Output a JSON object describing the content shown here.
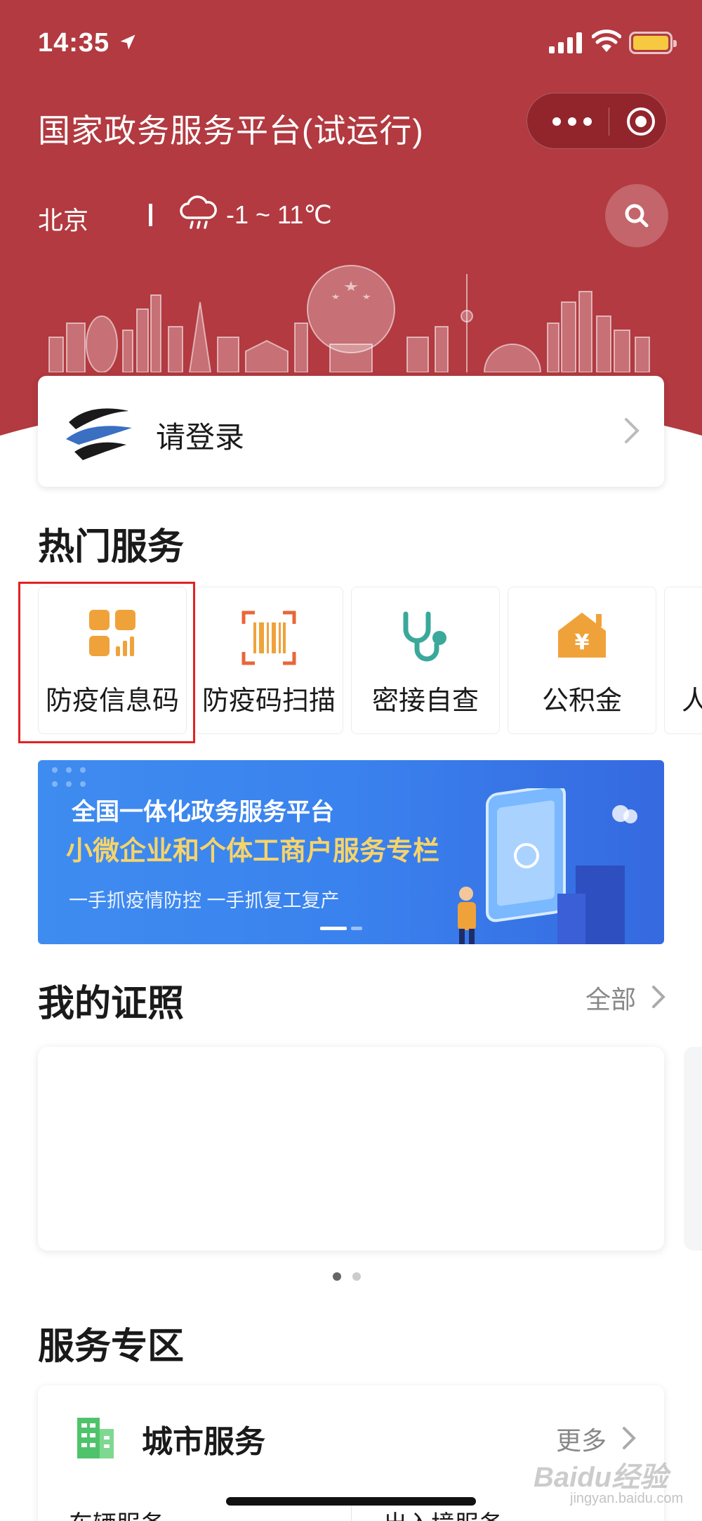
{
  "status_bar": {
    "time": "14:35"
  },
  "header": {
    "title": "国家政务服务平台(试运行)",
    "city": "北京",
    "weather": "-1 ~ 11℃"
  },
  "login": {
    "label": "请登录"
  },
  "hot_services": {
    "title": "热门服务",
    "items": [
      {
        "label": "防疫信息码",
        "icon": "grid-bars-icon"
      },
      {
        "label": "防疫码扫描",
        "icon": "barcode-scan-icon"
      },
      {
        "label": "密接自查",
        "icon": "stethoscope-icon"
      },
      {
        "label": "公积金",
        "icon": "house-yen-icon"
      },
      {
        "label": "人",
        "icon": ""
      }
    ]
  },
  "banner": {
    "line1": "全国一体化政务服务平台",
    "line2": "小微企业和个体工商户服务专栏",
    "line3": "一手抓疫情防控  一手抓复工复产"
  },
  "certificates": {
    "title": "我的证照",
    "all_label": "全部"
  },
  "service_zone": {
    "title": "服务专区",
    "card_title": "城市服务",
    "more_label": "更多",
    "items": [
      "车辆服务",
      "出入境服务"
    ]
  },
  "watermark": {
    "text": "Baidu经验",
    "sub": "jingyan.baidu.com"
  },
  "colors": {
    "header_red": "#b23a40",
    "accent_orange": "#f0a23a",
    "accent_teal": "#3aa89a",
    "highlight_red": "#e22222",
    "banner_blue": "#3a82ee",
    "banner_yellow": "#f6d46a"
  }
}
